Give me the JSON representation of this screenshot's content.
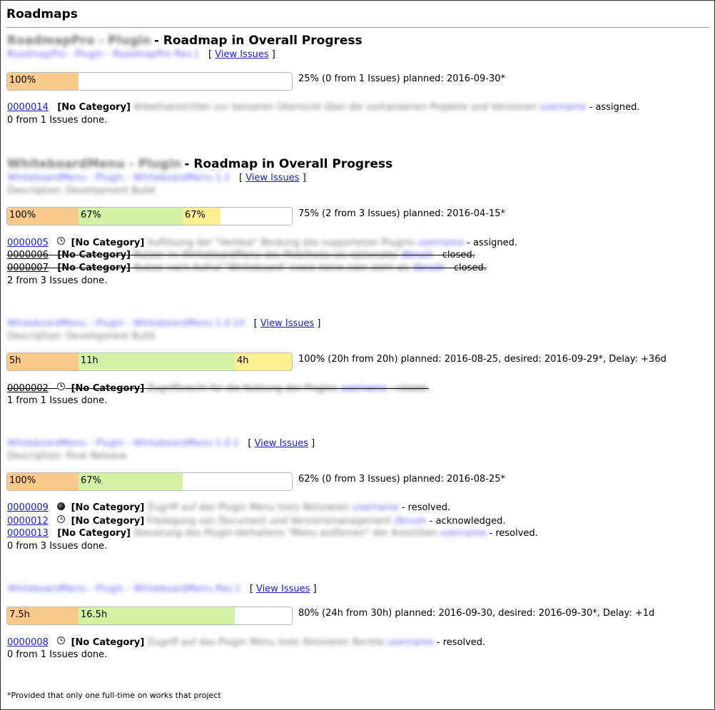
{
  "page": {
    "title": "Roadmaps",
    "footnote": "*Provided that only one full-time on works that project"
  },
  "sections": [
    {
      "title_suffix": "- Roadmap in Overall Progress",
      "view_issues": "View Issues",
      "bar": [
        "100%"
      ],
      "bar_percent": [
        0.25
      ],
      "summary": "25% (0 from 1 Issues)  planned: 2016-09-30*",
      "issues": [
        {
          "id": "0000014",
          "category": "[No Category]",
          "status": "- assigned."
        }
      ],
      "done": "0 from 1 Issues done."
    },
    {
      "title_suffix": "- Roadmap in Overall Progress",
      "view_issues": "View Issues",
      "bar": [
        "100%",
        "67%",
        "67%"
      ],
      "bar_percent": [
        0.25,
        0.366,
        0.133
      ],
      "summary": "75% (2 from 3 Issues)  planned: 2016-04-15*",
      "issues": [
        {
          "id": "0000005",
          "category": "[No Category]",
          "status": "- assigned."
        },
        {
          "id": "0000006",
          "category": "[No Category]",
          "status": "- closed."
        },
        {
          "id": "0000007",
          "category": "[No Category]",
          "status": "- closed."
        }
      ],
      "done": "2 from 3 Issues done."
    },
    {
      "view_issues": "View Issues",
      "bar": [
        "5h",
        "11h",
        "4h"
      ],
      "bar_percent": [
        0.25,
        0.55,
        0.2
      ],
      "summary": "100% (20h from 20h)  planned: 2016-08-25, desired: 2016-09-29*, Delay: +36d",
      "issues": [
        {
          "id": "0000002",
          "category": "[No Category]"
        }
      ],
      "done": "1 from 1 Issues done."
    },
    {
      "view_issues": "View Issues",
      "bar": [
        "100%",
        "67%"
      ],
      "bar_percent": [
        0.25,
        0.366
      ],
      "summary": "62% (0 from 3 Issues)  planned: 2016-08-25*",
      "issues": [
        {
          "id": "0000009",
          "category": "[No Category]",
          "status": "- resolved."
        },
        {
          "id": "0000012",
          "category": "[No Category]",
          "status": "- acknowledged."
        },
        {
          "id": "0000013",
          "category": "[No Category]",
          "status": "- resolved."
        }
      ],
      "done": "0 from 3 Issues done."
    },
    {
      "view_issues": "View Issues",
      "bar": [
        "7.5h",
        "16.5h"
      ],
      "bar_percent": [
        0.25,
        0.55
      ],
      "summary": "80% (24h from 30h)  planned: 2016-09-30, desired: 2016-09-30*, Delay: +1d",
      "issues": [
        {
          "id": "0000008",
          "category": "[No Category]",
          "status": "- resolved."
        }
      ],
      "done": "0 from 1 Issues done."
    }
  ]
}
